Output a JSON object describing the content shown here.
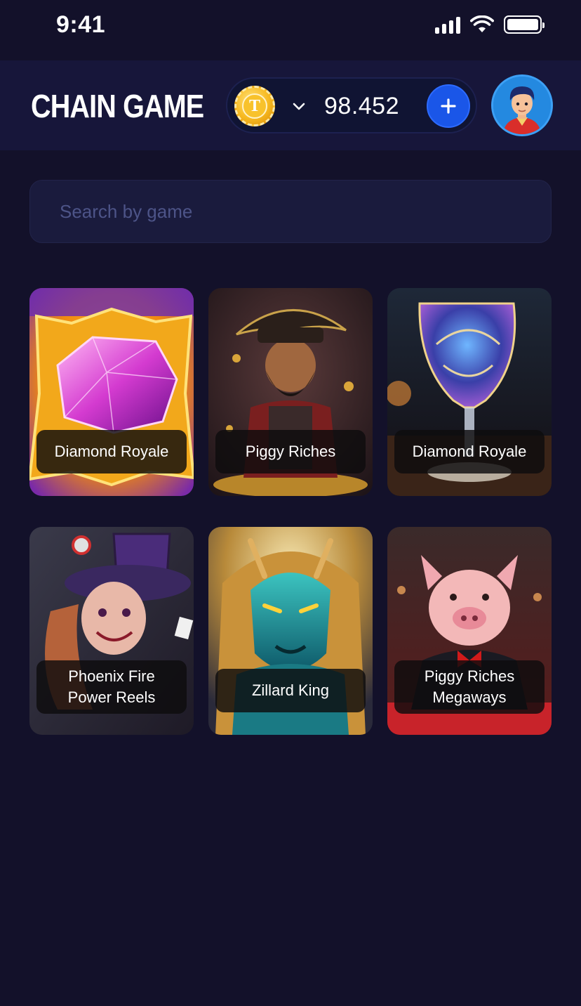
{
  "status_bar": {
    "time": "9:41"
  },
  "header": {
    "logo_text": "CHAIN GAME",
    "balance": "98.452",
    "coin_letter": "T"
  },
  "search": {
    "placeholder": "Search by game"
  },
  "games": [
    {
      "title": "Diamond Royale"
    },
    {
      "title": "Piggy Riches"
    },
    {
      "title": "Diamond Royale"
    },
    {
      "title": "Phoenix Fire\nPower Reels"
    },
    {
      "title": "Zillard King"
    },
    {
      "title": "Piggy Riches\nMegaways"
    }
  ],
  "colors": {
    "background": "#13112a",
    "header": "#17163a",
    "accent_blue": "#1a56e8",
    "coin_gold": "#f7b920",
    "placeholder": "#4d5488"
  },
  "icons": {
    "coin": "coin-icon",
    "dropdown": "chevron-down-icon",
    "add": "plus-icon",
    "avatar": "user-avatar"
  }
}
